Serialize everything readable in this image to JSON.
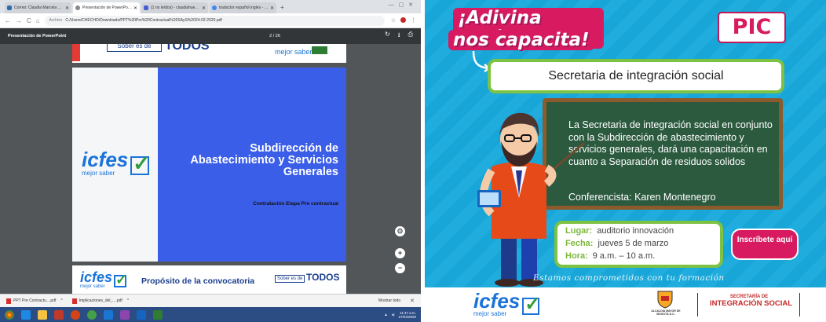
{
  "browser": {
    "tabs": [
      {
        "label": "Correo: Claudia Marcela Huertas",
        "color": "#2b6cb0",
        "active": false
      },
      {
        "label": "Presentación de PowerPoint",
        "color": "#666",
        "active": true
      },
      {
        "label": "(1 no leídos) - claudiahuertas@...",
        "color": "#4a5cd6",
        "active": false
      },
      {
        "label": "traductor español ingles - Buscar",
        "color": "#4285f4",
        "active": false
      }
    ],
    "url_host": "Archivo",
    "url": "C:/Users/CHECHO/Downloads/PPT%20Pre%20Contractual%20SAyS%2024-02-2020.pdf",
    "pdf_title": "Presentación de PowerPoint",
    "page_counter": "2 / 26",
    "zoom_controls": [
      "⊙",
      "+",
      "−"
    ],
    "downloads": [
      {
        "label": "PPT Pre Contractu....pdf"
      },
      {
        "label": "Implicaciones_del_....pdf"
      }
    ],
    "show_all": "Mostrar todo",
    "clock_time": "11:47 a.m.",
    "clock_date": "27/04/2020"
  },
  "slides": {
    "p1_sober": "Sober es de",
    "p1_todos": "TODOS",
    "p1_mejor": "mejor saber",
    "logo_word": "icfes",
    "logo_sub": "mejor saber",
    "main_title": "Subdirección de Abastecimiento y Servicios Generales",
    "subtitle": "Contratación Etapa Pre contractual",
    "p3_title": "Propósito de la convocatoria",
    "p3_sober": "Sober es de",
    "p3_todos": "TODOS"
  },
  "poster": {
    "line1": "¡Adivina quién",
    "line2": "nos capacita!",
    "badge": "PIC",
    "heading": "Secretaria de integración social",
    "body": "La Secretaria de integración social en conjunto con la Subdirección de abastecimiento y servicios generales, dará una capacitación en cuanto a Separación de residuos solidos",
    "speaker": "Conferencista: Karen Montenegro",
    "lugar_label": "Lugar:",
    "lugar": "auditorio innovación",
    "fecha_label": "Fecha:",
    "fecha": "jueves 5 de marzo",
    "hora_label": "Hora:",
    "hora": "9 a.m. – 10 a.m.",
    "cta": "Inscríbete aquí",
    "slogan": "Estamos comprometidos con tu formación",
    "footer_logo": "icfes",
    "footer_logo_sub": "mejor saber",
    "alcaldia": "ALCALDÍA MAYOR DE BOGOTÁ D.C.",
    "secretaria_a": "SECRETARÍA DE",
    "secretaria_b": "INTEGRACIÓN SOCIAL"
  },
  "colors": {
    "poster_bg": "#17a9db",
    "pink": "#d81b60",
    "green": "#7dc242",
    "slide_blue": "#3b5ee8"
  }
}
